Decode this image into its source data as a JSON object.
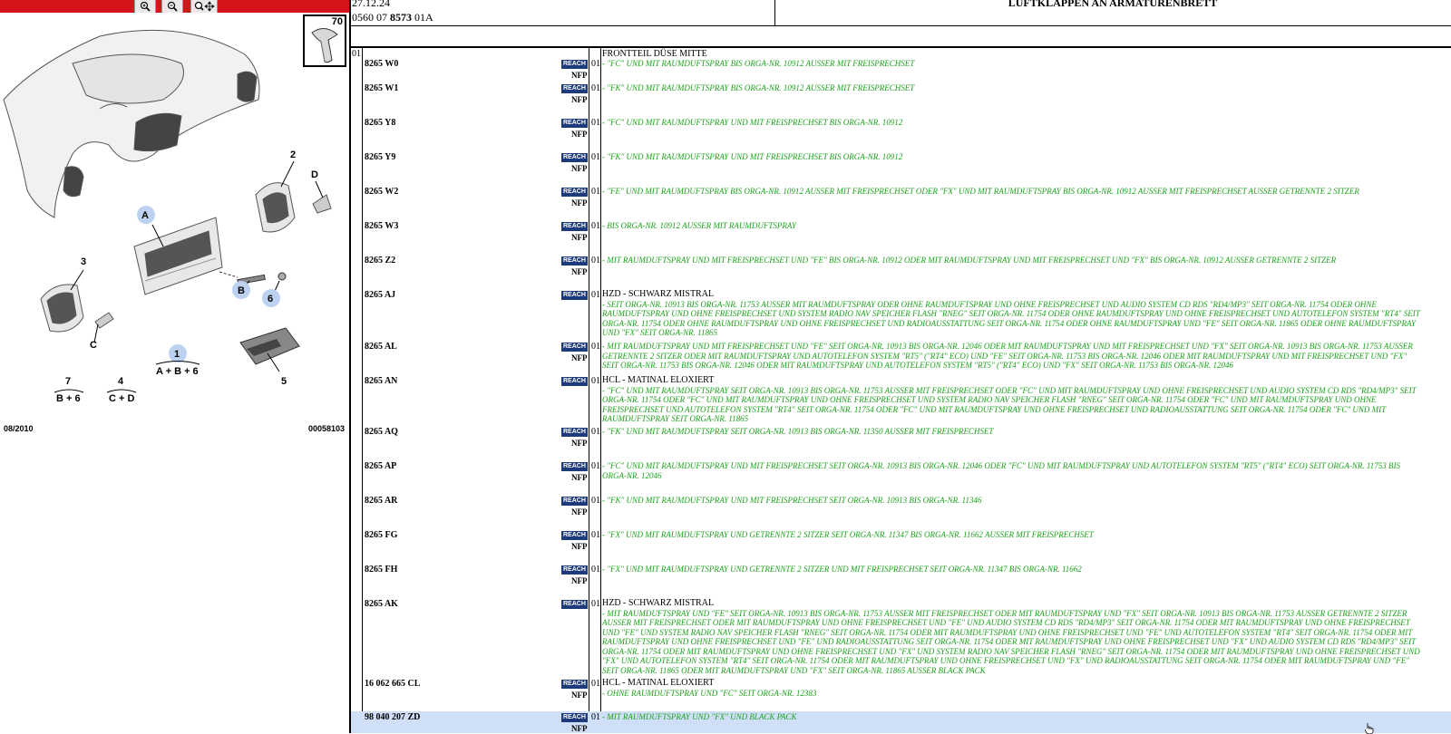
{
  "toolbar": {
    "icons": [
      "zoom-in-icon",
      "zoom-out-icon",
      "zoom-move-icon"
    ]
  },
  "illustration": {
    "thumb_number": "70",
    "callouts": [
      "2",
      "D",
      "A",
      "3",
      "B",
      "6",
      "C",
      "1",
      "5",
      "7",
      "4"
    ],
    "groups": [
      {
        "num": "1",
        "formula": "A + B + 6"
      },
      {
        "num": "7",
        "formula": "B + 6"
      },
      {
        "num": "4",
        "formula": "C + D"
      }
    ],
    "date": "08/2010",
    "code": "00058103"
  },
  "header": {
    "date": "27.12.24",
    "ref_prefix": "0560 07",
    "ref_bold": "8573",
    "ref_suffix": "01A",
    "title": "LUFTKLAPPEN AN ARMATURENBRETT"
  },
  "section_qty": "01",
  "rows": [
    {
      "ref": "",
      "reach": false,
      "nfp": false,
      "qty": "",
      "heading": "FRONTTEIL DÜSE MITTE",
      "text": ""
    },
    {
      "ref": "8265 W0",
      "reach": true,
      "nfp": true,
      "qty": "01",
      "heading": "",
      "text": "- \"FC\" UND MIT RAUMDUFTSPRAY BIS ORGA-NR. 10912 AUSSER MIT FREISPRECHSET"
    },
    {
      "ref": "8265 W1",
      "reach": true,
      "nfp": true,
      "qty": "01",
      "heading": "",
      "text": "- \"FK\" UND MIT RAUMDUFTSPRAY BIS ORGA-NR. 10912 AUSSER MIT FREISPRECHSET"
    },
    {
      "ref": "8265 Y8",
      "reach": true,
      "nfp": true,
      "qty": "01",
      "heading": "",
      "text": "- \"FC\" UND MIT RAUMDUFTSPRAY UND MIT FREISPRECHSET BIS ORGA-NR. 10912"
    },
    {
      "ref": "8265 Y9",
      "reach": true,
      "nfp": true,
      "qty": "01",
      "heading": "",
      "text": "- \"FK\" UND MIT RAUMDUFTSPRAY UND MIT FREISPRECHSET BIS ORGA-NR. 10912"
    },
    {
      "ref": "8265 W2",
      "reach": true,
      "nfp": true,
      "qty": "01",
      "heading": "",
      "text": "- \"FE\" UND MIT RAUMDUFTSPRAY BIS ORGA-NR. 10912 AUSSER MIT FREISPRECHSET ODER \"FX\" UND MIT RAUMDUFTSPRAY BIS ORGA-NR. 10912 AUSSER MIT FREISPRECHSET AUSSER GETRENNTE 2 SITZER"
    },
    {
      "ref": "8265 W3",
      "reach": true,
      "nfp": true,
      "qty": "01",
      "heading": "",
      "text": "- BIS ORGA-NR. 10912 AUSSER MIT RAUMDUFTSPRAY"
    },
    {
      "ref": "8265 Z2",
      "reach": true,
      "nfp": true,
      "qty": "01",
      "heading": "",
      "text": "- MIT RAUMDUFTSPRAY UND MIT FREISPRECHSET UND \"FE\" BIS ORGA-NR. 10912 ODER MIT RAUMDUFTSPRAY UND MIT FREISPRECHSET UND \"FX\" BIS ORGA-NR. 10912 AUSSER GETRENNTE 2 SITZER"
    },
    {
      "ref": "8265 AJ",
      "reach": true,
      "nfp": false,
      "qty": "01",
      "heading": "HZD - SCHWARZ MISTRAL",
      "text": "- SEIT ORGA-NR. 10913 BIS ORGA-NR. 11753 AUSSER MIT RAUMDUFTSPRAY ODER OHNE RAUMDUFTSPRAY UND OHNE FREISPRECHSET UND AUDIO SYSTEM CD RDS \"RD4/MP3\" SEIT ORGA-NR. 11754 ODER OHNE RAUMDUFTSPRAY UND OHNE FREISPRECHSET UND SYSTEM RADIO NAV SPEICHER FLASH \"RNEG\" SEIT ORGA-NR. 11754 ODER OHNE RAUMDUFTSPRAY UND OHNE FREISPRECHSET UND AUTOTELEFON SYSTEM \"RT4\" SEIT ORGA-NR. 11754 ODER OHNE RAUMDUFTSPRAY UND OHNE FREISPRECHSET UND RADIOAUSSTATTUNG SEIT ORGA-NR. 11754 ODER OHNE RAUMDUFTSPRAY UND \"FE\" SEIT ORGA-NR. 11865 ODER OHNE RAUMDUFTSPRAY UND \"FX\" SEIT ORGA-NR. 11865"
    },
    {
      "ref": "8265 AL",
      "reach": true,
      "nfp": true,
      "qty": "01",
      "heading": "",
      "text": "- MIT RAUMDUFTSPRAY UND MIT FREISPRECHSET UND \"FE\" SEIT ORGA-NR. 10913 BIS ORGA-NR. 12046 ODER MIT RAUMDUFTSPRAY UND MIT FREISPRECHSET UND \"FX\" SEIT ORGA-NR. 10913 BIS ORGA-NR. 11753 AUSSER GETRENNTE 2 SITZER ODER MIT RAUMDUFTSPRAY UND AUTOTELEFON SYSTEM \"RT5\" (\"RT4\" ECO) UND \"FE\" SEIT ORGA-NR. 11753 BIS ORGA-NR. 12046 ODER MIT RAUMDUFTSPRAY UND MIT FREISPRECHSET UND \"FX\" SEIT ORGA-NR. 11753 BIS ORGA-NR. 12046 ODER MIT RAUMDUFTSPRAY UND AUTOTELEFON SYSTEM \"RT5\" (\"RT4\" ECO) UND \"FX\" SEIT ORGA-NR. 11753 BIS ORGA-NR. 12046"
    },
    {
      "ref": "8265 AN",
      "reach": true,
      "nfp": false,
      "qty": "01",
      "heading": "HCL - MATINAL ELOXIERT",
      "text": "- \"FC\" UND MIT RAUMDUFTSPRAY SEIT ORGA-NR. 10913 BIS ORGA-NR. 11753 AUSSER MIT FREISPRECHSET ODER \"FC\" UND MIT RAUMDUFTSPRAY UND OHNE FREISPRECHSET UND AUDIO SYSTEM CD RDS \"RD4/MP3\" SEIT ORGA-NR. 11754 ODER \"FC\" UND MIT RAUMDUFTSPRAY UND OHNE FREISPRECHSET UND SYSTEM RADIO NAV SPEICHER FLASH \"RNEG\" SEIT ORGA-NR. 11754 ODER \"FC\" UND MIT RAUMDUFTSPRAY UND OHNE FREISPRECHSET UND AUTOTELEFON SYSTEM \"RT4\" SEIT ORGA-NR. 11754 ODER \"FC\" UND MIT RAUMDUFTSPRAY UND OHNE FREISPRECHSET UND RADIOAUSSTATTUNG SEIT ORGA-NR. 11754 ODER \"FC\" UND MIT RAUMDUFTSPRAY SEIT ORGA-NR. 11865"
    },
    {
      "ref": "8265 AQ",
      "reach": true,
      "nfp": true,
      "qty": "01",
      "heading": "",
      "text": "- \"FK\" UND MIT RAUMDUFTSPRAY SEIT ORGA-NR. 10913 BIS ORGA-NR. 11350 AUSSER MIT FREISPRECHSET"
    },
    {
      "ref": "8265 AP",
      "reach": true,
      "nfp": true,
      "qty": "01",
      "heading": "",
      "text": "- \"FC\" UND MIT RAUMDUFTSPRAY UND MIT FREISPRECHSET SEIT ORGA-NR. 10913 BIS ORGA-NR. 12046 ODER \"FC\" UND MIT RAUMDUFTSPRAY UND AUTOTELEFON SYSTEM \"RT5\" (\"RT4\" ECO) SEIT ORGA-NR. 11753 BIS ORGA-NR. 12046"
    },
    {
      "ref": "8265 AR",
      "reach": true,
      "nfp": true,
      "qty": "01",
      "heading": "",
      "text": "- \"FK\" UND MIT RAUMDUFTSPRAY UND MIT FREISPRECHSET SEIT ORGA-NR. 10913 BIS ORGA-NR. 11346"
    },
    {
      "ref": "8265 FG",
      "reach": true,
      "nfp": true,
      "qty": "01",
      "heading": "",
      "text": "- \"FX\" UND MIT RAUMDUFTSPRAY UND GETRENNTE 2 SITZER SEIT ORGA-NR. 11347 BIS ORGA-NR. 11662 AUSSER MIT FREISPRECHSET"
    },
    {
      "ref": "8265 FH",
      "reach": true,
      "nfp": true,
      "qty": "01",
      "heading": "",
      "text": "- \"FX\" UND MIT RAUMDUFTSPRAY UND GETRENNTE 2 SITZER UND MIT FREISPRECHSET SEIT ORGA-NR. 11347 BIS ORGA-NR. 11662"
    },
    {
      "ref": "8265 AK",
      "reach": true,
      "nfp": false,
      "qty": "01",
      "heading": "HZD - SCHWARZ MISTRAL",
      "text": "- MIT RAUMDUFTSPRAY UND \"FE\" SEIT ORGA-NR. 10913 BIS ORGA-NR. 11753 AUSSER MIT FREISPRECHSET ODER MIT RAUMDUFTSPRAY UND \"FX\" SEIT ORGA-NR. 10913 BIS ORGA-NR. 11753 AUSSER GETRENNTE 2 SITZER AUSSER MIT FREISPRECHSET ODER MIT RAUMDUFTSPRAY UND OHNE FREISPRECHSET UND \"FE\" UND AUDIO SYSTEM CD RDS \"RD4/MP3\" SEIT ORGA-NR. 11754 ODER MIT RAUMDUFTSPRAY UND OHNE FREISPRECHSET UND \"FE\" UND SYSTEM RADIO NAV SPEICHER FLASH \"RNEG\" SEIT ORGA-NR. 11754 ODER MIT RAUMDUFTSPRAY UND OHNE FREISPRECHSET UND \"FE\" UND AUTOTELEFON SYSTEM \"RT4\" SEIT ORGA-NR. 11754 ODER MIT RAUMDUFTSPRAY UND OHNE FREISPRECHSET UND \"FE\" UND RADIOAUSSTATTUNG SEIT ORGA-NR. 11754 ODER MIT RAUMDUFTSPRAY UND OHNE FREISPRECHSET UND \"FX\" UND AUDIO SYSTEM CD RDS \"RD4/MP3\" SEIT ORGA-NR. 11754 ODER MIT RAUMDUFTSPRAY UND OHNE FREISPRECHSET UND \"FX\" UND SYSTEM RADIO NAV SPEICHER FLASH \"RNEG\" SEIT ORGA-NR. 11754 ODER MIT RAUMDUFTSPRAY UND OHNE FREISPRECHSET UND \"FX\" UND AUTOTELEFON SYSTEM \"RT4\" SEIT ORGA-NR. 11754 ODER MIT RAUMDUFTSPRAY UND OHNE FREISPRECHSET UND \"FX\" UND RADIOAUSSTATTUNG SEIT ORGA-NR. 11754 ODER MIT RAUMDUFTSPRAY UND \"FE\" SEIT ORGA-NR. 11865 ODER MIT RAUMDUFTSPRAY UND \"FX\" SEIT ORGA-NR. 11865 AUSSER BLACK PACK"
    },
    {
      "ref": "16 062 665 CL",
      "reach": true,
      "nfp": true,
      "qty": "01",
      "heading": "HCL - MATINAL ELOXIERT",
      "text": "- OHNE RAUMDUFTSPRAY UND \"FC\" SEIT ORGA-NR. 12383"
    },
    {
      "ref": "98 040 207 ZD",
      "reach": true,
      "nfp": true,
      "qty": "01",
      "heading": "",
      "text": "- MIT RAUMDUFTSPRAY UND \"FX\" UND BLACK PACK",
      "highlight": true
    }
  ],
  "reach_label": "REACH",
  "nfp_label": "NFP"
}
